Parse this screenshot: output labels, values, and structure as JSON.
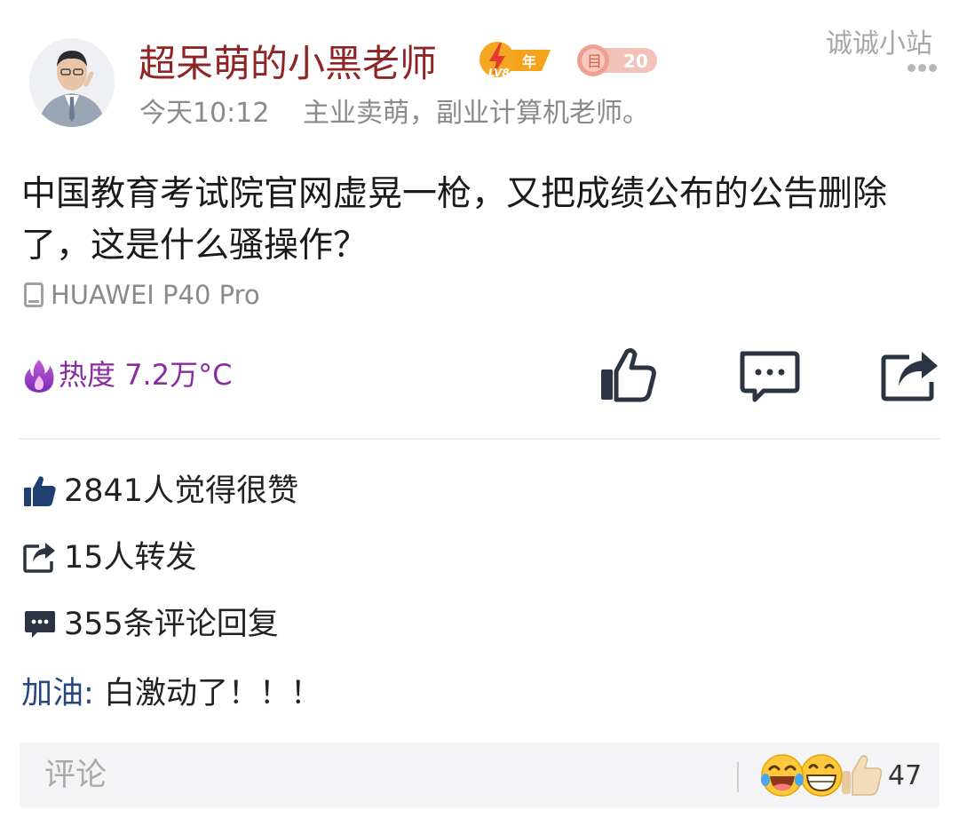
{
  "header": {
    "author_name": "超呆萌的小黑老师",
    "level_badge": "LV8",
    "year_badge": "年",
    "fan_badge_glyph": "目",
    "fan_badge_count": "20",
    "time": "今天10:12",
    "bio": "主业卖萌，副业计算机老师。",
    "watermark": "诚诚小站"
  },
  "post": {
    "text": "中国教育考试院官网虚晃一枪，又把成绩公布的公告删除了，这是什么骚操作？",
    "device": "HUAWEI P40 Pro",
    "heat_label": "热度",
    "heat_value": "7.2万°C"
  },
  "stats": {
    "likes": "2841人觉得很赞",
    "reposts": "15人转发",
    "comments": "355条评论回复"
  },
  "hot_comment": {
    "user": "加油",
    "separator": ":",
    "text": " 白激动了！！！"
  },
  "comment_bar": {
    "placeholder": "评论",
    "reaction_count": "47"
  },
  "colors": {
    "author_name": "#8e2424",
    "heat": "#8a2b9e",
    "comment_user": "#27477e",
    "icon_dark": "#2b3442",
    "like_blue": "#1e3f6f"
  },
  "icons": [
    "avatar",
    "level-badge",
    "fan-badge",
    "more-icon",
    "phone-icon",
    "flame-icon",
    "thumbs-up-icon",
    "comment-icon",
    "share-icon",
    "laughing-emoji",
    "grinning-emoji",
    "thumb-emoji"
  ]
}
